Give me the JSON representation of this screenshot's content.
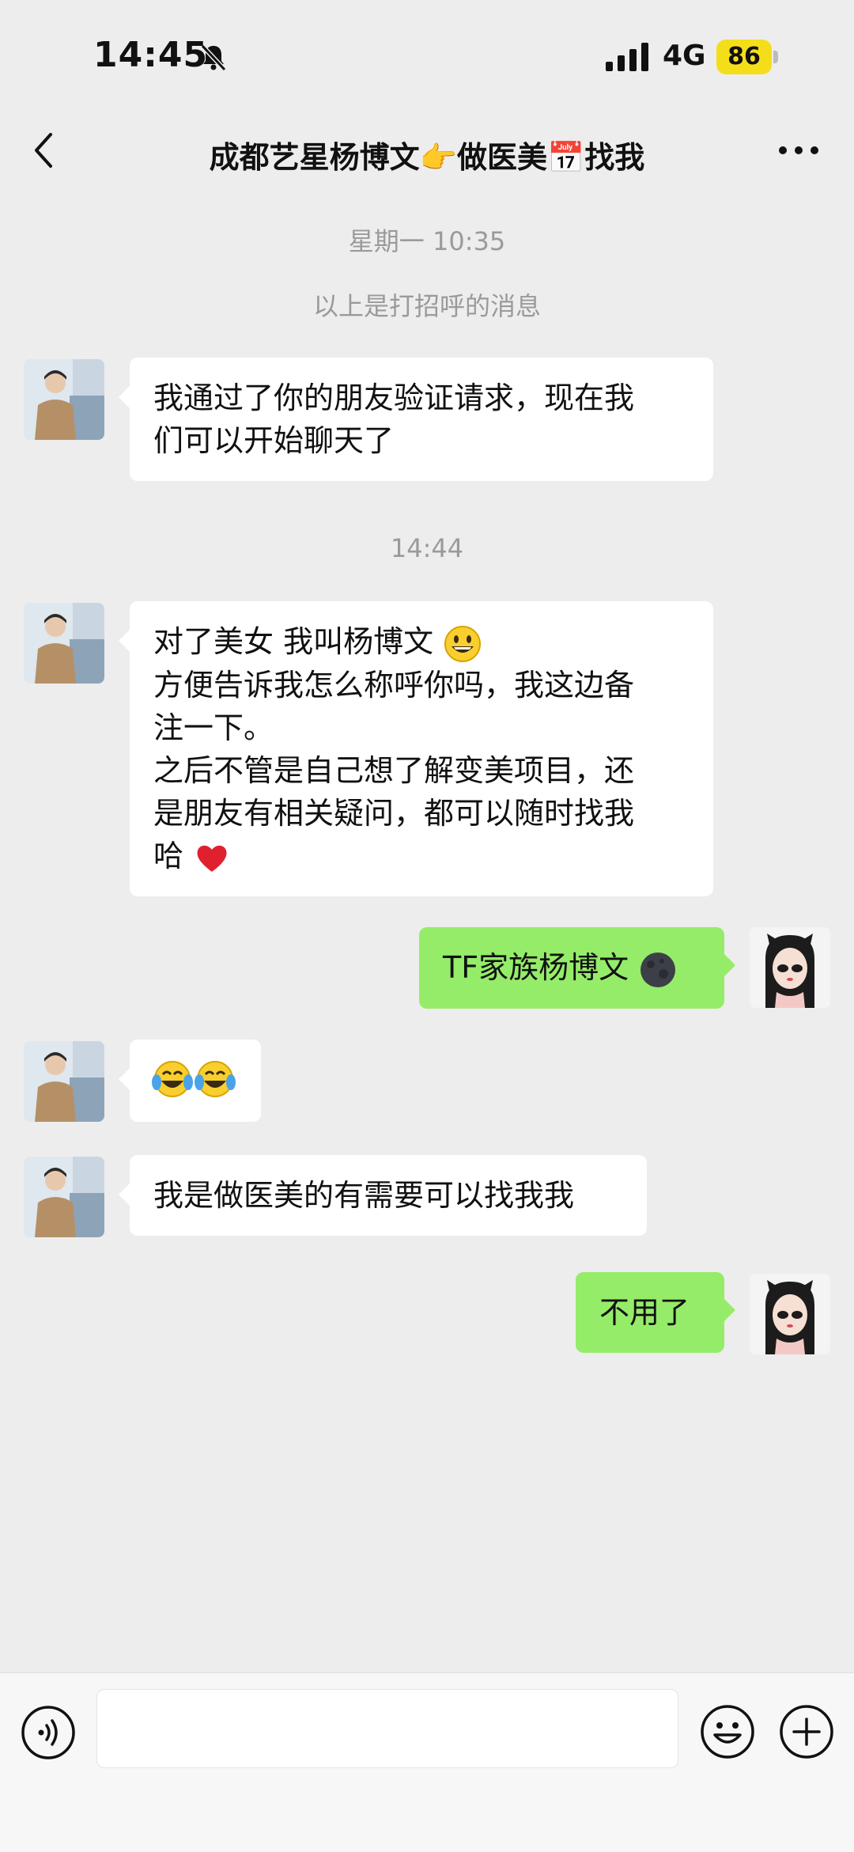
{
  "status": {
    "time": "14:45",
    "network": "4G",
    "battery": "86"
  },
  "header": {
    "title": "成都艺星杨博文👉做医美📅找我"
  },
  "meta": {
    "date_stamp": "星期一 10:35",
    "greeting_note": "以上是打招呼的消息",
    "time_stamp": "14:44"
  },
  "messages": [
    {
      "side": "left",
      "lines": [
        "我通过了你的朋友验证请求，现在我",
        "们可以开始聊天了"
      ]
    },
    {
      "side": "left",
      "line1": "对了美女   我叫杨博文",
      "line2": "方便告诉我怎么称呼你吗，我这边备",
      "line3": "注一下。",
      "line4": "之后不管是自己想了解变美项目，还",
      "line5": "是朋友有相关疑问，都可以随时找我",
      "line6": "哈"
    },
    {
      "side": "right",
      "text": "TF家族杨博文"
    },
    {
      "side": "left",
      "text": ""
    },
    {
      "side": "left",
      "text": "我是做医美的有需要可以找我我"
    },
    {
      "side": "right",
      "text": "不用了"
    }
  ],
  "icons": [
    "back-icon",
    "more-icon",
    "bell-muted-icon",
    "signal-icon",
    "voice-icon",
    "emoji-icon",
    "plus-icon",
    "grinning-emoji",
    "red-heart-emoji",
    "dark-moon-emoji",
    "tears-of-joy-emoji"
  ],
  "colors": {
    "sent_bubble": "#95ec69",
    "received_bubble": "#ffffff",
    "background": "#ededed",
    "battery": "#f4de1a"
  }
}
